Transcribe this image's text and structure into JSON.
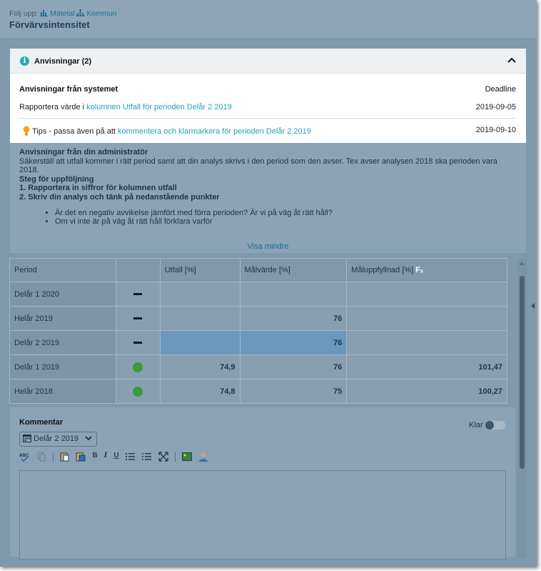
{
  "header": {
    "follow_label": "Följ upp:",
    "link_metric": "Mätetal",
    "link_municipality": "Kommun",
    "title": "Förvärvsintensitet"
  },
  "instructions": {
    "title": "Anvisningar (2)",
    "system_title": "Anvisningar från systemet",
    "deadline_label": "Deadline",
    "row1_prefix": "Rapportera värde i ",
    "row1_link": "kolumnen Utfall för perioden Delår 2 2019",
    "row1_date": "2019-09-05",
    "row2_prefix": "Tips - passa även på att ",
    "row2_link": "kommentera och klarmarkera för perioden Delår 2 2019",
    "row2_date": "2019-09-10",
    "admin_title": "Anvisningar från din administratör",
    "admin_text": "Säkerställ att utfall kommer i rätt period samt att din analys skrivs i den period som den avser. Tex avser analysen 2018 ska perioden vara 2018.",
    "steps_title": "Steg för uppföljning",
    "step1": "1. Rapportera in siffror för kolumnen utfall",
    "step2": "2. Skriv din analys och tänk på nedanstående punkter",
    "bullet1": "Är det en negativ avvikelse jämfört med förra perioden? Är vi på väg åt rätt håll?",
    "bullet2": "Om vi inte är på väg åt rätt håll förklara varför",
    "show_less": "Visa mindre"
  },
  "table": {
    "columns": [
      "Period",
      "",
      "Utfall [%]",
      "Målvärde [%]",
      "Måluppfyllnad [%]"
    ],
    "fx_label": "Fₓ",
    "rows": [
      {
        "period": "Delår 1 2020",
        "status": "dash",
        "utfall": "",
        "malvarde": "",
        "maluppfyllnad": ""
      },
      {
        "period": "Helår 2019",
        "status": "dash",
        "utfall": "",
        "malvarde": "76",
        "maluppfyllnad": ""
      },
      {
        "period": "Delår 2 2019",
        "status": "dash",
        "utfall": "",
        "malvarde": "76",
        "maluppfyllnad": ""
      },
      {
        "period": "Delår 1 2019",
        "status": "green",
        "utfall": "74,9",
        "malvarde": "76",
        "maluppfyllnad": "101,47"
      },
      {
        "period": "Helår 2018",
        "status": "green",
        "utfall": "74,8",
        "malvarde": "75",
        "maluppfyllnad": "100,27"
      }
    ],
    "status_green_color": "#3d9a3c"
  },
  "comment": {
    "title": "Kommentar",
    "done_label": "Klar",
    "done_on": false,
    "period_value": "Delår 2 2019",
    "toolbar": {
      "bold": "B",
      "italic": "I",
      "underline": "U"
    }
  },
  "colors": {
    "accent": "#1aa6b8",
    "overlay": "#7f99ad",
    "highlight_cell": "#6b98bf"
  }
}
